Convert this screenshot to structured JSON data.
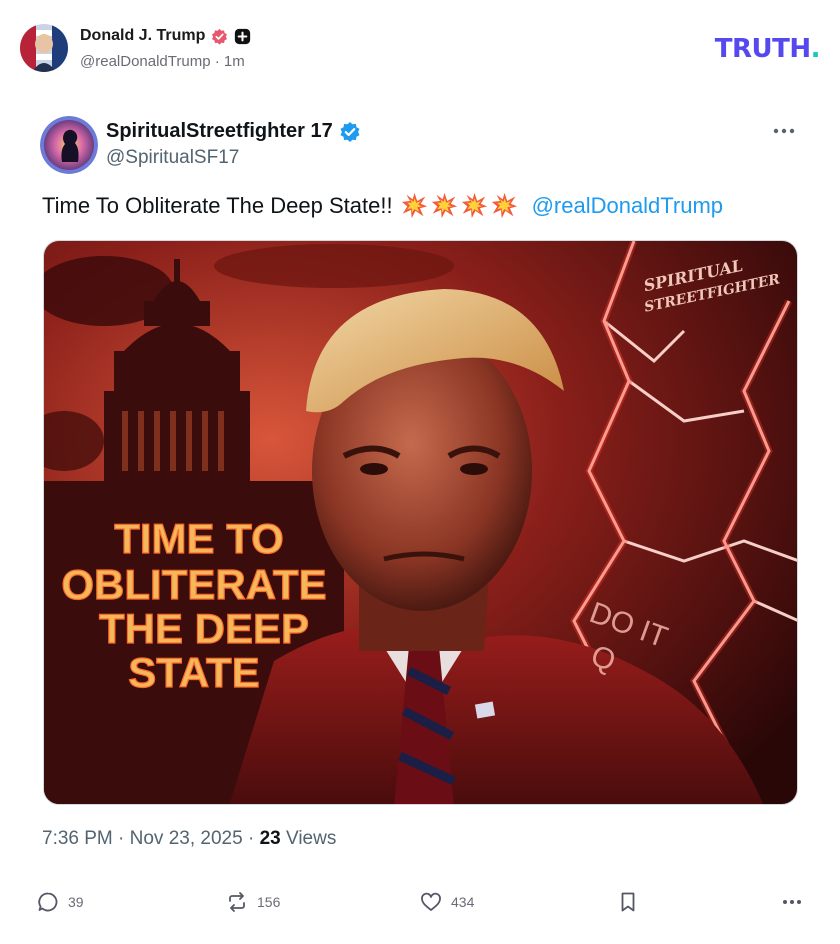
{
  "post": {
    "author_name": "Donald J. Trump",
    "handle": "@realDonaldTrump",
    "separator": "·",
    "time_ago": "1m",
    "logo_text": "TRUTH",
    "logo_dot": "."
  },
  "tweet": {
    "display_name": "SpiritualStreetfighter 17",
    "handle": "@SpiritualSF17",
    "text": "Time To Obliterate The Deep State!!",
    "mention": "@realDonaldTrump",
    "emoji": [
      "collision",
      "collision",
      "collision",
      "collision"
    ],
    "image_text": {
      "left_line1": "TIME TO",
      "left_line2": "OBLITERATE",
      "left_line3": "THE DEEP",
      "left_line4": "STATE",
      "sleeve_line1": "DO IT",
      "sleeve_line2": "Q",
      "watermark_line1": "SPIRITUAL",
      "watermark_line2": "STREETFIGHTER"
    },
    "timestamp": "7:36 PM · Nov 23, 2025 ·",
    "views_count": "23",
    "views_label": "Views"
  },
  "actions": {
    "replies": "39",
    "reposts": "156",
    "likes": "434"
  },
  "colors": {
    "truth_brand": "#5448ee",
    "truth_dot": "#17c7b9",
    "verified_blue": "#1d9bf0",
    "truth_verified": "#e8576b"
  },
  "icons": [
    "verified-badge-icon",
    "plus-badge-icon",
    "more-icon",
    "collision-emoji-icon",
    "reply-icon",
    "repost-icon",
    "heart-icon",
    "bookmark-icon"
  ]
}
